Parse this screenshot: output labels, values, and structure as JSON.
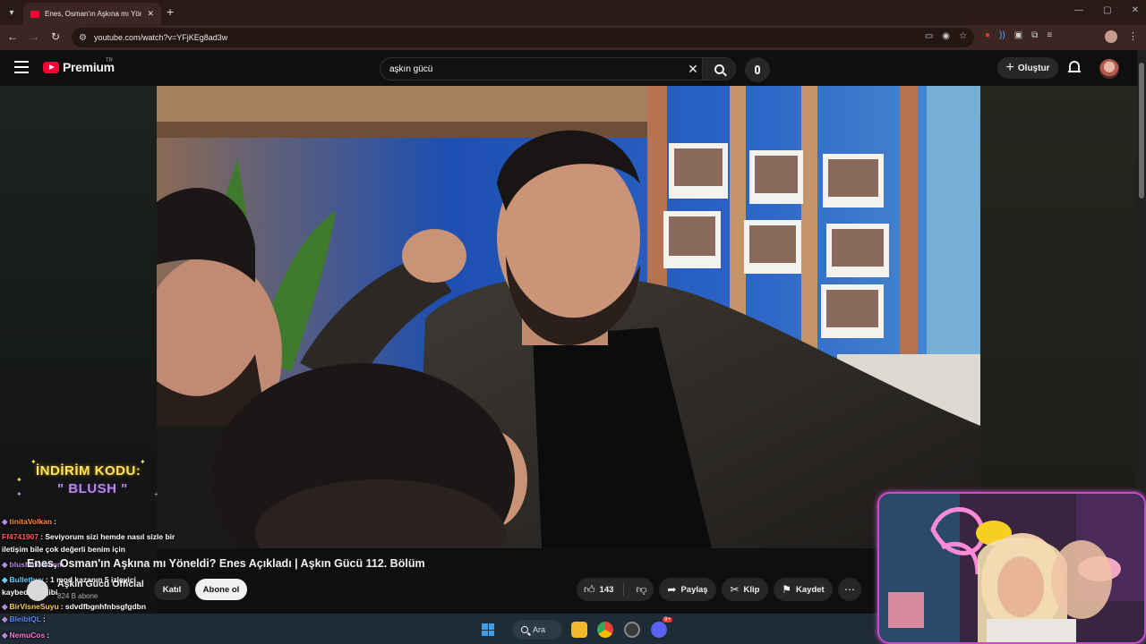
{
  "browser": {
    "tab_title": "Enes, Osman'ın Aşkına mı Yönel",
    "url": "youtube.com/watch?v=YFjKEg8ad3w",
    "new_tab_label": "+",
    "tab_close_label": "✕"
  },
  "youtube": {
    "logo_text": "Premium",
    "logo_region": "TR",
    "search_value": "aşkın gücü",
    "create_label": "Oluştur"
  },
  "video": {
    "title": "Enes, Osman'ın Aşkına mı Yöneldi? Enes Açıkladı | Aşkın Gücü 112. Bölüm",
    "channel": "Aşkın Gücü Official",
    "subscribers": "824 B abone",
    "join_label": "Katıl",
    "subscribe_label": "Abone ol",
    "likes": "143",
    "share_label": "Paylaş",
    "clip_label": "Klip",
    "save_label": "Kaydet"
  },
  "overlay": {
    "promo_line1": "İNDİRİM KODU:",
    "promo_line2": "\" BLUSH \"",
    "chat": [
      {
        "user": "tinitaVolkan",
        "user_color": "#ff8a3c",
        "text": ":"
      },
      {
        "user": "Ff4741907",
        "user_color": "#ff5a5a",
        "text": ": Seviyorum sizi hemde nasıl sizle bir"
      },
      {
        "user": "",
        "user_color": "#ffffff",
        "text": "iletişim bile çok değerli benim için"
      },
      {
        "user": "blushmoonmm",
        "user_color": "#b48be0",
        "text": ""
      },
      {
        "user": "Bulletbyy",
        "user_color": "#6ad0ff",
        "text": ": 1 mod kazanın 5 izleyici"
      },
      {
        "user": "",
        "user_color": "#ffffff",
        "text": "kaybedin :( gibi"
      },
      {
        "user": "BirVisneSuyu",
        "user_color": "#ffcc55",
        "text": ": sdvdfbgnhfnbsgfgdbn"
      },
      {
        "user": "BleibtQL",
        "user_color": "#5a8cff",
        "text": ":"
      },
      {
        "user": "NemuCos",
        "user_color": "#ff7ad9",
        "text": ":"
      }
    ]
  },
  "taskbar": {
    "search_label": "Ara",
    "discord_badge": "9+"
  },
  "icons": [
    "chevron-down-icon",
    "youtube-favicon",
    "close-icon",
    "back-icon",
    "forward-icon",
    "reload-icon",
    "site-settings-icon",
    "cast-icon",
    "eye-off-icon",
    "star-icon",
    "extensions-icon",
    "menu-icon",
    "search-icon",
    "mic-icon",
    "bell-icon",
    "like-icon",
    "dislike-icon",
    "share-icon",
    "scissors-icon",
    "bookmark-icon",
    "more-icon",
    "windows-icon"
  ],
  "colors": {
    "chrome_frame": "#2a1a17",
    "youtube_red": "#ff0033",
    "webcam_border": "#c84cc8"
  }
}
